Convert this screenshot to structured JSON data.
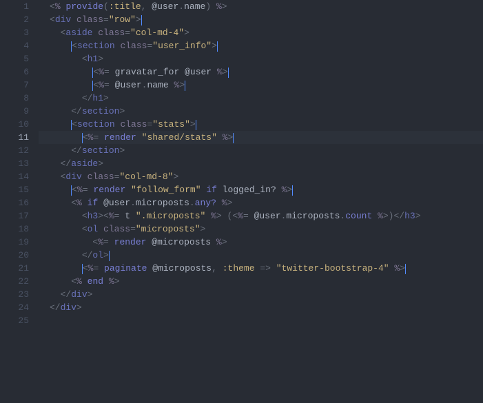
{
  "active_line": 11,
  "lines": [
    {
      "n": 1,
      "indent": 0,
      "tokens": [
        [
          "pun",
          "<"
        ],
        [
          "pct",
          "%"
        ],
        [
          "pun",
          " "
        ],
        [
          "kw",
          "provide"
        ],
        [
          "op",
          "("
        ],
        [
          "sym",
          ":title"
        ],
        [
          "op",
          ", "
        ],
        [
          "gvar",
          "@user"
        ],
        [
          "op",
          "."
        ],
        [
          "gvar",
          "name"
        ],
        [
          "op",
          ") "
        ],
        [
          "pct",
          "%"
        ],
        [
          "pun",
          ">"
        ]
      ]
    },
    {
      "n": 2,
      "indent": 0,
      "tokens": [
        [
          "pun",
          "<"
        ],
        [
          "tag",
          "div"
        ],
        [
          "pun",
          " "
        ],
        [
          "attr",
          "class"
        ],
        [
          "pun",
          "="
        ],
        [
          "str",
          "\"row\""
        ],
        [
          "pun",
          ">"
        ]
      ],
      "caret_after": true
    },
    {
      "n": 3,
      "indent": 1,
      "tokens": [
        [
          "pun",
          "<"
        ],
        [
          "tag",
          "aside"
        ],
        [
          "pun",
          " "
        ],
        [
          "attr",
          "class"
        ],
        [
          "pun",
          "="
        ],
        [
          "str",
          "\"col-md-4\""
        ],
        [
          "pun",
          ">"
        ]
      ]
    },
    {
      "n": 4,
      "indent": 2,
      "tokens": [
        [
          "pun",
          "<"
        ],
        [
          "tag",
          "section"
        ],
        [
          "pun",
          " "
        ],
        [
          "attr",
          "class"
        ],
        [
          "pun",
          "="
        ],
        [
          "str",
          "\"user_info\""
        ],
        [
          "pun",
          ">"
        ]
      ],
      "caret_before": true,
      "caret_after": true
    },
    {
      "n": 5,
      "indent": 3,
      "tokens": [
        [
          "pun",
          "<"
        ],
        [
          "tag",
          "h1"
        ],
        [
          "pun",
          ">"
        ]
      ]
    },
    {
      "n": 6,
      "indent": 4,
      "tokens": [
        [
          "pun",
          "<"
        ],
        [
          "pct",
          "%"
        ],
        [
          "pun",
          "= "
        ],
        [
          "fn",
          "gravatar_for"
        ],
        [
          "pun",
          " "
        ],
        [
          "gvar",
          "@user"
        ],
        [
          "pun",
          " "
        ],
        [
          "pct",
          "%"
        ],
        [
          "pun",
          ">"
        ]
      ],
      "caret_before": true,
      "caret_after": true
    },
    {
      "n": 7,
      "indent": 4,
      "tokens": [
        [
          "pun",
          "<"
        ],
        [
          "pct",
          "%"
        ],
        [
          "pun",
          "= "
        ],
        [
          "gvar",
          "@user"
        ],
        [
          "op",
          "."
        ],
        [
          "gvar",
          "name"
        ],
        [
          "pun",
          " "
        ],
        [
          "pct",
          "%"
        ],
        [
          "pun",
          ">"
        ]
      ],
      "caret_before": true,
      "caret_after": true
    },
    {
      "n": 8,
      "indent": 3,
      "tokens": [
        [
          "pun",
          "</"
        ],
        [
          "tag",
          "h1"
        ],
        [
          "pun",
          ">"
        ]
      ]
    },
    {
      "n": 9,
      "indent": 2,
      "tokens": [
        [
          "pun",
          "</"
        ],
        [
          "tag",
          "section"
        ],
        [
          "pun",
          ">"
        ]
      ]
    },
    {
      "n": 10,
      "indent": 2,
      "tokens": [
        [
          "pun",
          "<"
        ],
        [
          "tag",
          "section"
        ],
        [
          "pun",
          " "
        ],
        [
          "attr",
          "class"
        ],
        [
          "pun",
          "="
        ],
        [
          "str",
          "\"stats\""
        ],
        [
          "pun",
          ">"
        ]
      ],
      "caret_before": true,
      "caret_after": true
    },
    {
      "n": 11,
      "indent": 3,
      "tokens": [
        [
          "pun",
          "<"
        ],
        [
          "pct",
          "%"
        ],
        [
          "pun",
          "= "
        ],
        [
          "kw",
          "render"
        ],
        [
          "pun",
          " "
        ],
        [
          "str",
          "\"shared/stats\""
        ],
        [
          "pun",
          " "
        ],
        [
          "pct",
          "%"
        ],
        [
          "pun",
          ">"
        ]
      ],
      "caret_before": true,
      "caret_after": true
    },
    {
      "n": 12,
      "indent": 2,
      "tokens": [
        [
          "pun",
          "</"
        ],
        [
          "tag",
          "section"
        ],
        [
          "pun",
          ">"
        ]
      ]
    },
    {
      "n": 13,
      "indent": 1,
      "tokens": [
        [
          "pun",
          "</"
        ],
        [
          "tag",
          "aside"
        ],
        [
          "pun",
          ">"
        ]
      ]
    },
    {
      "n": 14,
      "indent": 1,
      "tokens": [
        [
          "pun",
          "<"
        ],
        [
          "tag",
          "div"
        ],
        [
          "pun",
          " "
        ],
        [
          "attr",
          "class"
        ],
        [
          "pun",
          "="
        ],
        [
          "str",
          "\"col-md-8\""
        ],
        [
          "pun",
          ">"
        ]
      ]
    },
    {
      "n": 15,
      "indent": 2,
      "tokens": [
        [
          "pun",
          "<"
        ],
        [
          "pct",
          "%"
        ],
        [
          "pun",
          "= "
        ],
        [
          "kw",
          "render"
        ],
        [
          "pun",
          " "
        ],
        [
          "str",
          "\"follow_form\""
        ],
        [
          "pun",
          " "
        ],
        [
          "kw",
          "if"
        ],
        [
          "pun",
          " "
        ],
        [
          "fn",
          "logged_in?"
        ],
        [
          "pun",
          " "
        ],
        [
          "pct",
          "%"
        ],
        [
          "pun",
          ">"
        ]
      ],
      "caret_before": true,
      "caret_after": true
    },
    {
      "n": 16,
      "indent": 2,
      "tokens": [
        [
          "pun",
          "<"
        ],
        [
          "pct",
          "%"
        ],
        [
          "pun",
          " "
        ],
        [
          "kw",
          "if"
        ],
        [
          "pun",
          " "
        ],
        [
          "gvar",
          "@user"
        ],
        [
          "op",
          "."
        ],
        [
          "gvar",
          "microposts"
        ],
        [
          "op",
          "."
        ],
        [
          "kw",
          "any?"
        ],
        [
          "pun",
          " "
        ],
        [
          "pct",
          "%"
        ],
        [
          "pun",
          ">"
        ]
      ]
    },
    {
      "n": 17,
      "indent": 3,
      "tokens": [
        [
          "pun",
          "<"
        ],
        [
          "tag",
          "h3"
        ],
        [
          "pun",
          "><"
        ],
        [
          "pct",
          "%"
        ],
        [
          "pun",
          "= "
        ],
        [
          "fn",
          "t"
        ],
        [
          "pun",
          " "
        ],
        [
          "str",
          "\".microposts\""
        ],
        [
          "pun",
          " "
        ],
        [
          "pct",
          "%"
        ],
        [
          "pun",
          "> ("
        ],
        [
          "pun",
          "<"
        ],
        [
          "pct",
          "%"
        ],
        [
          "pun",
          "= "
        ],
        [
          "gvar",
          "@user"
        ],
        [
          "op",
          "."
        ],
        [
          "gvar",
          "microposts"
        ],
        [
          "op",
          "."
        ],
        [
          "kw",
          "count"
        ],
        [
          "pun",
          " "
        ],
        [
          "pct",
          "%"
        ],
        [
          "pun",
          ">)"
        ],
        [
          "pun",
          "<"
        ],
        [
          "pun",
          "/"
        ],
        [
          "tag",
          "h3"
        ],
        [
          "pun",
          ">"
        ]
      ],
      "caret_mid": true
    },
    {
      "n": 18,
      "indent": 3,
      "tokens": [
        [
          "pun",
          "<"
        ],
        [
          "tag",
          "ol"
        ],
        [
          "pun",
          " "
        ],
        [
          "attr",
          "class"
        ],
        [
          "pun",
          "="
        ],
        [
          "str",
          "\"microposts\""
        ],
        [
          "pun",
          ">"
        ]
      ]
    },
    {
      "n": 19,
      "indent": 4,
      "tokens": [
        [
          "pun",
          "<"
        ],
        [
          "pct",
          "%"
        ],
        [
          "pun",
          "= "
        ],
        [
          "kw",
          "render"
        ],
        [
          "pun",
          " "
        ],
        [
          "gvar",
          "@microposts"
        ],
        [
          "pun",
          " "
        ],
        [
          "pct",
          "%"
        ],
        [
          "pun",
          ">"
        ]
      ]
    },
    {
      "n": 20,
      "indent": 3,
      "tokens": [
        [
          "pun",
          "</"
        ],
        [
          "tag",
          "ol"
        ],
        [
          "pun",
          ">"
        ]
      ],
      "caret_after": true
    },
    {
      "n": 21,
      "indent": 3,
      "tokens": [
        [
          "pun",
          "<"
        ],
        [
          "pct",
          "%"
        ],
        [
          "pun",
          "= "
        ],
        [
          "kw",
          "paginate"
        ],
        [
          "pun",
          " "
        ],
        [
          "gvar",
          "@microposts"
        ],
        [
          "op",
          ", "
        ],
        [
          "sym",
          ":theme"
        ],
        [
          "pun",
          " => "
        ],
        [
          "str",
          "\"twitter-bootstrap-4\""
        ],
        [
          "pun",
          " "
        ],
        [
          "pct",
          "%"
        ],
        [
          "pun",
          ">"
        ]
      ],
      "caret_before": true,
      "caret_after": true
    },
    {
      "n": 22,
      "indent": 2,
      "tokens": [
        [
          "pun",
          "<"
        ],
        [
          "pct",
          "%"
        ],
        [
          "pun",
          " "
        ],
        [
          "kw",
          "end"
        ],
        [
          "pun",
          " "
        ],
        [
          "pct",
          "%"
        ],
        [
          "pun",
          ">"
        ]
      ]
    },
    {
      "n": 23,
      "indent": 1,
      "tokens": [
        [
          "pun",
          "</"
        ],
        [
          "tag",
          "div"
        ],
        [
          "pun",
          ">"
        ]
      ]
    },
    {
      "n": 24,
      "indent": 0,
      "tokens": [
        [
          "pun",
          "</"
        ],
        [
          "tag",
          "div"
        ],
        [
          "pun",
          ">"
        ]
      ]
    },
    {
      "n": 25,
      "indent": 0,
      "tokens": []
    }
  ]
}
